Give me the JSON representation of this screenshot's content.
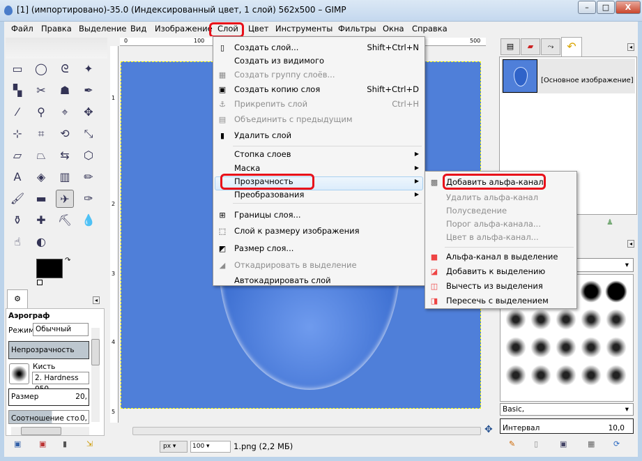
{
  "window": {
    "title": "[1] (импортировано)-35.0 (Индексированный цвет, 1 слой) 562x500 – GIMP",
    "minimize": "–",
    "maximize": "□",
    "close": "X"
  },
  "menubar": [
    "Файл",
    "Правка",
    "Выделение",
    "Вид",
    "Изображение",
    "Слой",
    "Цвет",
    "Инструменты",
    "Фильтры",
    "Окна",
    "Справка"
  ],
  "layer_menu": {
    "items": [
      {
        "label": "Создать слой...",
        "shortcut": "Shift+Ctrl+N",
        "icon": "new-layer-icon",
        "enabled": true
      },
      {
        "label": "Создать из видимого",
        "shortcut": "",
        "icon": "",
        "enabled": true
      },
      {
        "label": "Создать группу слоёв...",
        "shortcut": "",
        "icon": "layer-group-icon",
        "enabled": false
      },
      {
        "label": "Создать копию слоя",
        "shortcut": "Shift+Ctrl+D",
        "icon": "duplicate-layer-icon",
        "enabled": true
      },
      {
        "label": "Прикрепить слой",
        "shortcut": "Ctrl+H",
        "icon": "anchor-icon",
        "enabled": false
      },
      {
        "label": "Объединить с предыдущим",
        "shortcut": "",
        "icon": "merge-down-icon",
        "enabled": false
      },
      {
        "label": "Удалить слой",
        "shortcut": "",
        "icon": "trash-icon",
        "enabled": true
      },
      {
        "label": "Стопка слоев",
        "submenu": true
      },
      {
        "label": "Маска",
        "submenu": true
      },
      {
        "label": "Прозрачность",
        "submenu": true,
        "highlighted": true
      },
      {
        "label": "Преобразования",
        "submenu": true
      },
      {
        "label": "Границы слоя...",
        "icon": "layer-boundary-icon",
        "enabled": true
      },
      {
        "label": "Слой к размеру изображения",
        "icon": "layer-to-image-size-icon",
        "enabled": true
      },
      {
        "label": "Размер слоя...",
        "icon": "scale-layer-icon",
        "enabled": true
      },
      {
        "label": "Откадрировать в выделение",
        "icon": "crop-icon",
        "enabled": false
      },
      {
        "label": "Автокадрировать слой",
        "icon": "",
        "enabled": true
      }
    ]
  },
  "transparency_submenu": {
    "items": [
      {
        "label": "Добавить альфа-канал",
        "enabled": true,
        "icon": "checker-icon",
        "highlighted": true
      },
      {
        "label": "Удалить альфа-канал",
        "enabled": false
      },
      {
        "label": "Полусведение",
        "enabled": false
      },
      {
        "label": "Порог альфа-канала...",
        "enabled": false
      },
      {
        "label": "Цвет в альфа-канал...",
        "enabled": false
      },
      {
        "label": "Альфа-канал в выделение",
        "enabled": true,
        "icon": "alpha-to-selection-icon"
      },
      {
        "label": "Добавить к выделению",
        "enabled": true,
        "icon": "add-selection-icon"
      },
      {
        "label": "Вычесть из выделения",
        "enabled": true,
        "icon": "subtract-selection-icon"
      },
      {
        "label": "Пересечь с выделением",
        "enabled": true,
        "icon": "intersect-selection-icon"
      }
    ]
  },
  "rulers": {
    "top": [
      "0",
      "100",
      "500"
    ],
    "left": [
      "1",
      "2",
      "3",
      "4",
      "5"
    ]
  },
  "tool_options": {
    "title": "Аэрограф",
    "mode_label": "Режим:",
    "mode_value": "Обычный",
    "opacity_label": "Непрозрачность",
    "brush_label": "Кисть",
    "brush_value": "2. Hardness 050",
    "size_label": "Размер",
    "size_value": "20,",
    "aspect_label": "Соотношение сто...",
    "aspect_value": "0,"
  },
  "statusbar": {
    "unit": "px",
    "zoom": "100",
    "file_info": "1.png (2,2 МБ)"
  },
  "layers_panel": {
    "layer_name": "[Основное изображение]"
  },
  "brushes_panel": {
    "preset": "Basic,",
    "spacing_label": "Интервал",
    "spacing_value": "10,0"
  },
  "colors": {
    "accent_red": "#e8101a",
    "image_blue": "#4f7fd9",
    "menu_highlight": "#dcecfb"
  }
}
